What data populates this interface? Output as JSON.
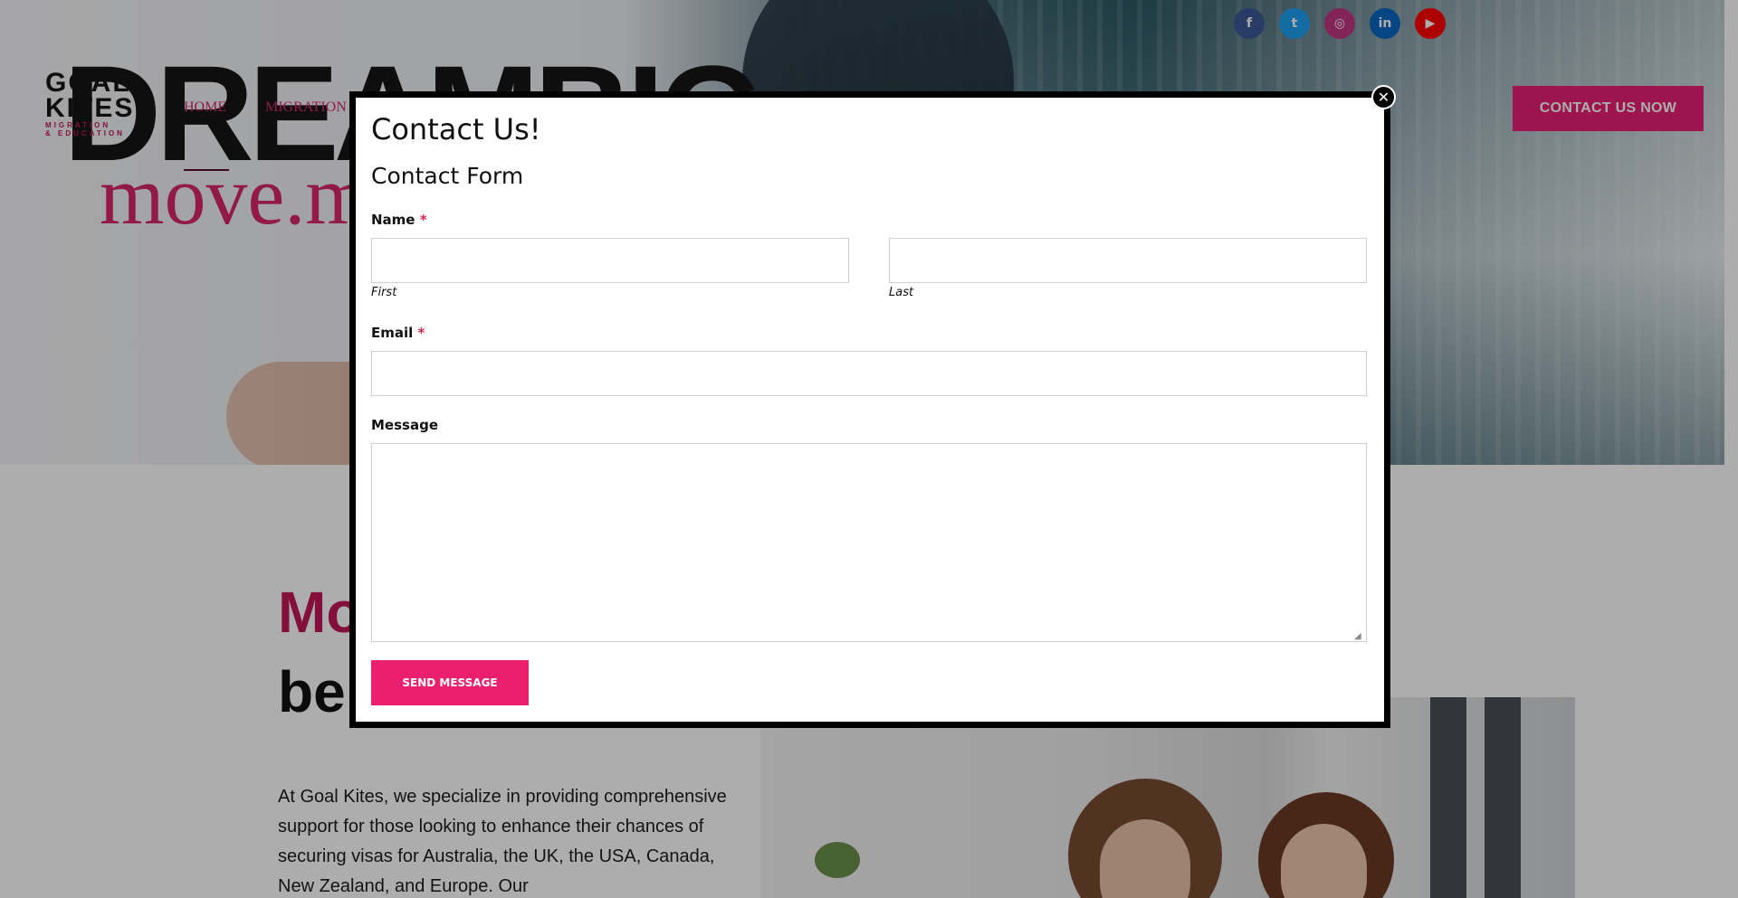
{
  "social": [
    {
      "name": "facebook-icon",
      "glyph": "f",
      "color": "#3b5998"
    },
    {
      "name": "twitter-icon",
      "glyph": "t",
      "color": "#1da1f2"
    },
    {
      "name": "instagram-icon",
      "glyph": "◎",
      "color": "#c13584"
    },
    {
      "name": "linkedin-icon",
      "glyph": "in",
      "color": "#0a66c2"
    },
    {
      "name": "youtube-icon",
      "glyph": "▶",
      "color": "#ff0000"
    }
  ],
  "header": {
    "logo_line1": "GOAL",
    "logo_line2": "KITES",
    "logo_line3": "MIGRATION",
    "logo_line4": "& EDUCATION",
    "nav": [
      "HOME",
      "MIGRATION"
    ],
    "cta_label": "CONTACT US NOW"
  },
  "hero": {
    "big_word": "DREAMBIG",
    "slogan": "move.m"
  },
  "main": {
    "heading_pink": "Mo",
    "heading_dark": "be",
    "about_text": "At Goal Kites, we specialize in providing comprehensive support for those looking to enhance their chances of securing visas for Australia, the UK, the USA, Canada, New Zealand, and Europe. Our"
  },
  "modal": {
    "title": "Contact Us!",
    "subtitle": "Contact Form",
    "name_label": "Name",
    "required_mark": "*",
    "first_label": "First",
    "last_label": "Last",
    "email_label": "Email",
    "message_label": "Message",
    "first_value": "",
    "last_value": "",
    "email_value": "",
    "message_value": "",
    "send_label": "SEND MESSAGE",
    "close_glyph": "✕"
  },
  "colors": {
    "accent_pink": "#e91e74",
    "required_red": "#e0244e"
  }
}
